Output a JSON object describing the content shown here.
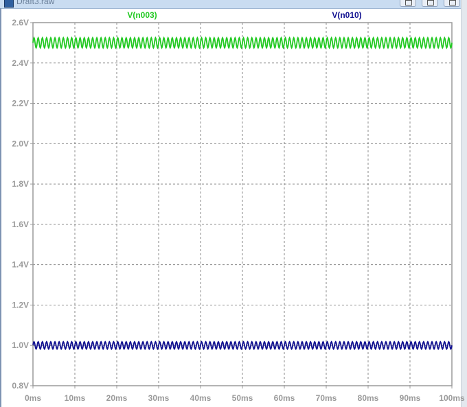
{
  "window": {
    "title": "Draft3.raw"
  },
  "chart_data": {
    "type": "line",
    "title": "",
    "xlabel": "",
    "ylabel": "",
    "xlim": [
      0,
      100
    ],
    "ylim": [
      0.8,
      2.6
    ],
    "x_unit": "ms",
    "y_unit": "V",
    "x_ticks": [
      "0ms",
      "10ms",
      "20ms",
      "30ms",
      "40ms",
      "50ms",
      "60ms",
      "70ms",
      "80ms",
      "90ms",
      "100ms"
    ],
    "y_ticks": [
      "2.6V",
      "2.4V",
      "2.2V",
      "2.0V",
      "1.8V",
      "1.6V",
      "1.4V",
      "1.2V",
      "1.0V",
      "0.8V"
    ],
    "grid": true,
    "legend_position": "top",
    "series": [
      {
        "name": "V(n003)",
        "color": "#22c922",
        "center": 2.5,
        "amplitude": 0.025,
        "cycles": 100
      },
      {
        "name": "V(n010)",
        "color": "#101090",
        "center": 1.0,
        "amplitude": 0.018,
        "cycles": 100
      }
    ]
  }
}
